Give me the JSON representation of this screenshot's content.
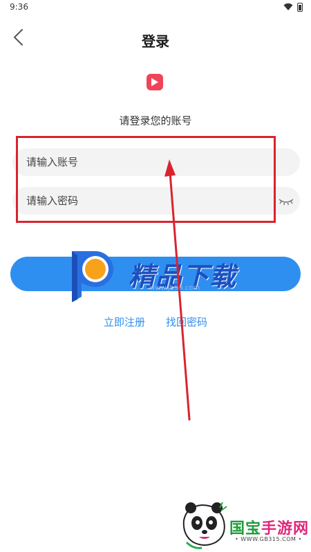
{
  "status_bar": {
    "time": "9:36"
  },
  "header": {
    "title": "登录"
  },
  "subtitle": "请登录您的账号",
  "form": {
    "account_placeholder": "请输入账号",
    "password_placeholder": "请输入密码"
  },
  "links": {
    "register": "立即注册",
    "forgot_password": "找回密码"
  },
  "watermark_top": {
    "text": "精品下载",
    "url": "www.jb9p.com"
  },
  "watermark_bottom": {
    "text_part1": "国宝",
    "text_part2": "手游网",
    "url": "• WWW.GB315.COM •"
  },
  "colors": {
    "accent": "#2f8ff0",
    "logo": "#f0445a",
    "highlight": "#d9232e"
  }
}
